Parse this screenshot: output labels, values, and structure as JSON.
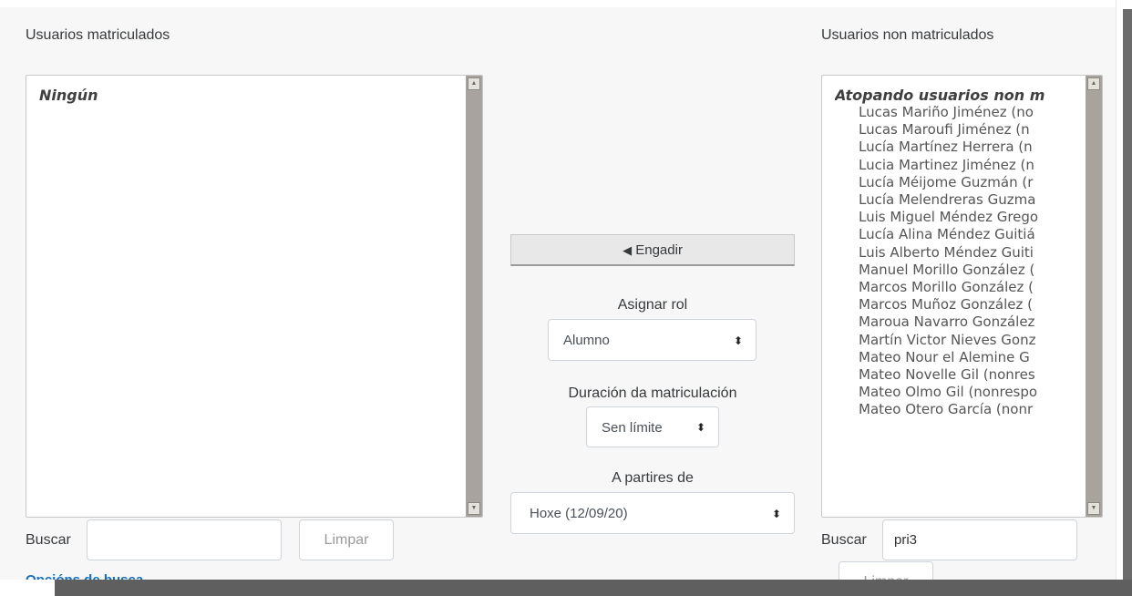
{
  "enrolled": {
    "heading": "Usuarios matriculados",
    "group_label": "Ningún",
    "search_label": "Buscar",
    "search_value": "",
    "clear_label": "Limpar",
    "options_link": "Opcións de busca"
  },
  "middle": {
    "add_arrow": "◀",
    "add_label": "Engadir",
    "assign_role_label": "Asignar rol",
    "role_value": "Alumno",
    "duration_label": "Duración da matriculación",
    "duration_value": "Sen límite",
    "start_label": "A partires de",
    "start_value": "Hoxe (12/09/20)",
    "caret": "⬍"
  },
  "not_enrolled": {
    "heading": "Usuarios non matriculados",
    "group_label": "Atopando usuarios non m",
    "items": [
      "Lucas Mariño Jiménez (no",
      "Lucas Maroufi Jiménez (n",
      "Lucía Martínez Herrera (n",
      "Lucia Martinez Jiménez (n",
      "Lucía Méijome Guzmán (r",
      "Lucía Melendreras Guzma",
      "Luis Miguel Méndez Grego",
      "Lucía Alina Méndez Guitiá",
      "Luis Alberto Méndez Guiti",
      "Manuel Morillo González (",
      "Marcos Morillo González (",
      "Marcos Muñoz González (",
      "Maroua Navarro González",
      "Martín Victor Nieves Gonz",
      "Mateo Nour el Alemine G",
      "Mateo Novelle Gil (nonres",
      "Mateo Olmo Gil (nonrespo",
      "Mateo Otero García (nonr"
    ],
    "search_label": "Buscar",
    "search_value": "pri3",
    "clear_label": "Limpar"
  }
}
